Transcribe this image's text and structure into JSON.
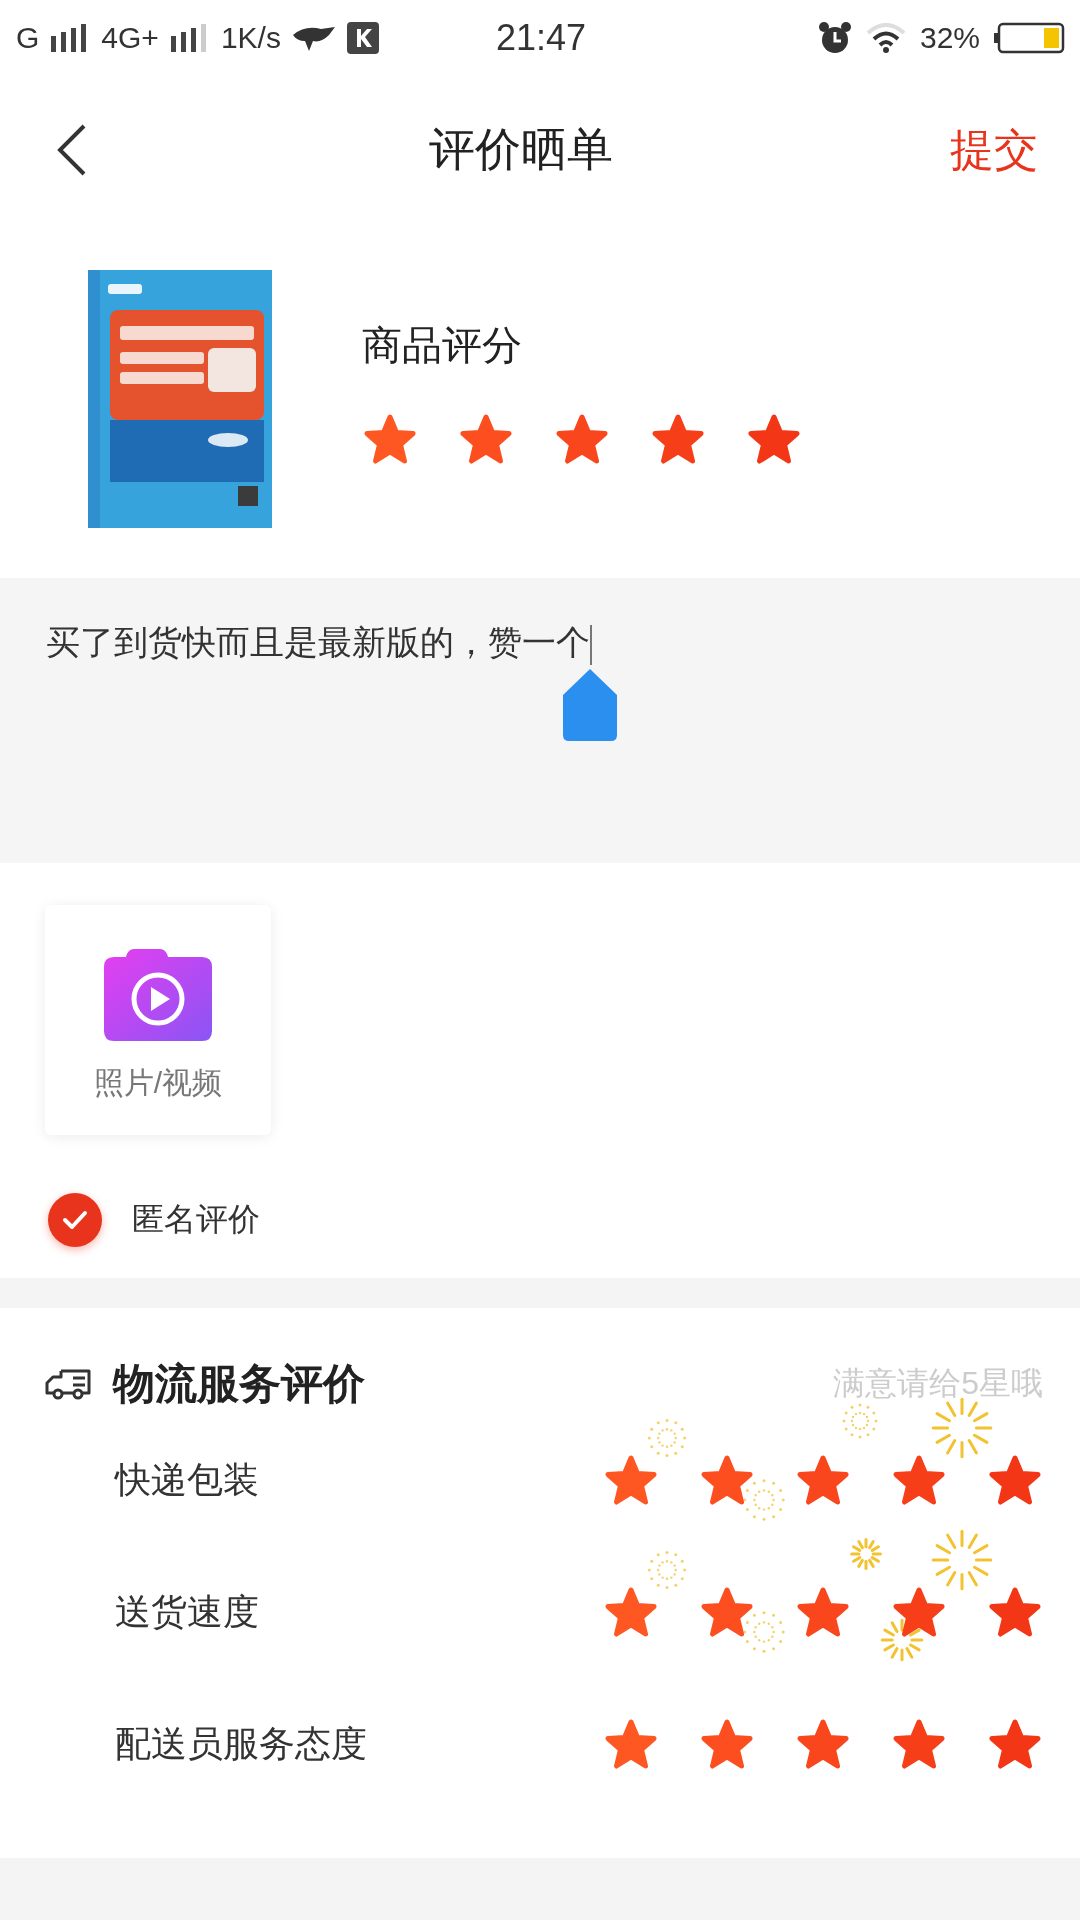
{
  "status_bar": {
    "carrier_1": "G",
    "carrier_2": "4G+",
    "speed": "1K/s",
    "time": "21:47",
    "battery": "32%"
  },
  "nav": {
    "title": "评价晒单",
    "submit": "提交"
  },
  "product": {
    "rating_label": "商品评分",
    "stars": 5
  },
  "review": {
    "value": "买了到货快而且是最新版的，赞一个"
  },
  "media": {
    "label": "照片/视频"
  },
  "anonymous": {
    "label": "匿名评价",
    "checked": true
  },
  "logistics": {
    "title": "物流服务评价",
    "hint": "满意请给5星哦",
    "ratings": [
      {
        "label": "快递包装",
        "stars": 5
      },
      {
        "label": "送货速度",
        "stars": 5
      },
      {
        "label": "配送员服务态度",
        "stars": 5
      }
    ]
  }
}
